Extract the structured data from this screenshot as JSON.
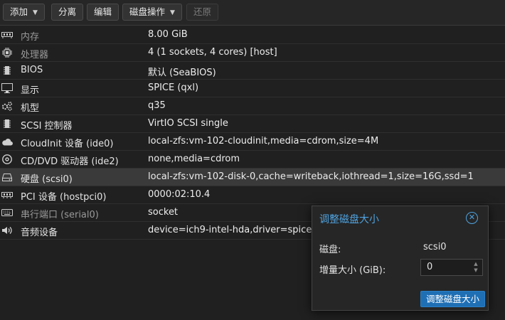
{
  "toolbar": {
    "add_label": "添加",
    "detach_label": "分离",
    "edit_label": "编辑",
    "disk_action_label": "磁盘操作",
    "revert_label": "还原"
  },
  "hardware": [
    {
      "icon": "memory-icon",
      "name": "内存",
      "value": "8.00 GiB"
    },
    {
      "icon": "cpu-icon",
      "name": "处理器",
      "value": "4 (1 sockets, 4 cores) [host]"
    },
    {
      "icon": "bios-icon",
      "name": "BIOS",
      "value": "默认 (SeaBIOS)"
    },
    {
      "icon": "display-icon",
      "name": "显示",
      "value": "SPICE (qxl)"
    },
    {
      "icon": "cogs-icon",
      "name": "机型",
      "value": "q35"
    },
    {
      "icon": "controller-icon",
      "name": "SCSI 控制器",
      "value": "VirtIO SCSI single"
    },
    {
      "icon": "cloud-icon",
      "name": "CloudInit 设备 (ide0)",
      "value": "local-zfs:vm-102-cloudinit,media=cdrom,size=4M"
    },
    {
      "icon": "cdrom-icon",
      "name": "CD/DVD 驱动器 (ide2)",
      "value": "none,media=cdrom"
    },
    {
      "icon": "harddisk-icon",
      "name": "硬盘 (scsi0)",
      "value": "local-zfs:vm-102-disk-0,cache=writeback,iothread=1,size=16G,ssd=1"
    },
    {
      "icon": "pci-icon",
      "name": "PCI 设备 (hostpci0)",
      "value": "0000:02:10.4"
    },
    {
      "icon": "keyboard-icon",
      "name": "串行端口 (serial0)",
      "value": "socket"
    },
    {
      "icon": "speaker-icon",
      "name": "音频设备",
      "value": "device=ich9-intel-hda,driver=spice"
    }
  ],
  "dialog": {
    "title": "调整磁盘大小",
    "disk_label": "磁盘:",
    "disk_value": "scsi0",
    "increment_label": "增量大小 (GiB):",
    "increment_value": "0",
    "submit_label": "调整磁盘大小"
  },
  "colors": {
    "accent": "#4fa3e0",
    "primary_button": "#1f6fb5",
    "background": "#202020",
    "selected_row": "#3a3a3a"
  }
}
